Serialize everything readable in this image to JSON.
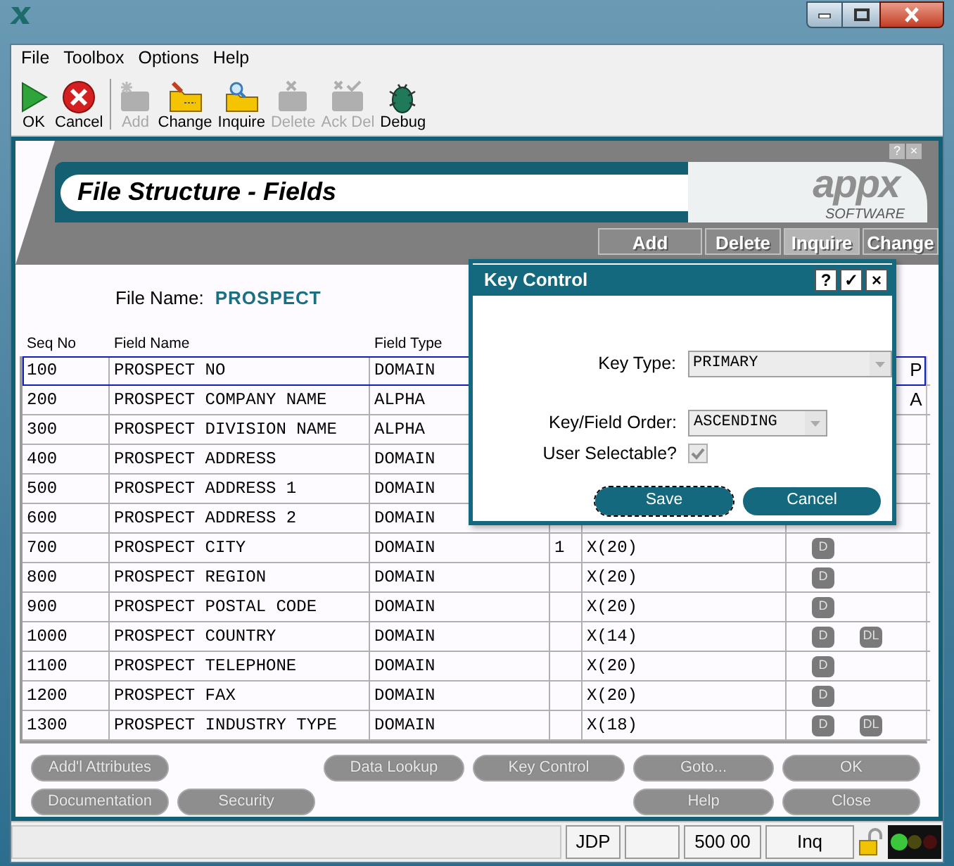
{
  "menu": [
    {
      "label": "File"
    },
    {
      "label": "Toolbox"
    },
    {
      "label": "Options"
    },
    {
      "label": "Help"
    }
  ],
  "toolbar": [
    {
      "kind": "ok",
      "label": "OK",
      "disabled": false
    },
    {
      "kind": "cancel",
      "label": "Cancel",
      "disabled": false
    },
    {
      "kind": "add",
      "label": "Add",
      "disabled": true
    },
    {
      "kind": "change",
      "label": "Change",
      "disabled": false
    },
    {
      "kind": "inquire",
      "label": "Inquire",
      "disabled": false
    },
    {
      "kind": "delete",
      "label": "Delete",
      "disabled": true
    },
    {
      "kind": "ackdel",
      "label": "Ack Del",
      "disabled": true
    },
    {
      "kind": "debug",
      "label": "Debug",
      "disabled": false
    }
  ],
  "screen": {
    "corner_buttons": [
      "?",
      "×"
    ],
    "title": "File Structure - Fields",
    "logo": "appx",
    "logo_sub": "SOFTWARE",
    "modes": [
      {
        "label": "Add",
        "selected": false
      },
      {
        "label": "Delete",
        "selected": false
      },
      {
        "label": "Inquire",
        "selected": true
      },
      {
        "label": "Change",
        "selected": false
      }
    ],
    "file_name_label": "File Name:",
    "file_name": "PROSPECT",
    "columns": [
      "Seq No",
      "Field Name",
      "Field Type"
    ],
    "rows": [
      {
        "seq": "100",
        "name": "PROSPECT NO",
        "type": "DOMAIN",
        "key": "P",
        "selected": true
      },
      {
        "seq": "200",
        "name": "PROSPECT COMPANY NAME",
        "type": "ALPHA",
        "key": "A",
        "selected": false
      },
      {
        "seq": "300",
        "name": "PROSPECT DIVISION NAME",
        "type": "ALPHA",
        "selected": false
      },
      {
        "seq": "400",
        "name": "PROSPECT ADDRESS",
        "type": "DOMAIN",
        "selected": false
      },
      {
        "seq": "500",
        "name": "PROSPECT ADDRESS 1",
        "type": "DOMAIN",
        "selected": false
      },
      {
        "seq": "600",
        "name": "PROSPECT ADDRESS 2",
        "type": "DOMAIN",
        "selected": false
      },
      {
        "seq": "700",
        "name": "PROSPECT CITY",
        "type": "DOMAIN",
        "length": "1",
        "format": "X(20)",
        "badges": [
          "D"
        ],
        "selected": false
      },
      {
        "seq": "800",
        "name": "PROSPECT REGION",
        "type": "DOMAIN",
        "format": "X(20)",
        "badges": [
          "D"
        ],
        "selected": false
      },
      {
        "seq": "900",
        "name": "PROSPECT POSTAL CODE",
        "type": "DOMAIN",
        "format": "X(20)",
        "badges": [
          "D"
        ],
        "selected": false
      },
      {
        "seq": "1000",
        "name": "PROSPECT COUNTRY",
        "type": "DOMAIN",
        "format": "X(14)",
        "badges": [
          "D",
          "DL"
        ],
        "selected": false
      },
      {
        "seq": "1100",
        "name": "PROSPECT TELEPHONE",
        "type": "DOMAIN",
        "format": "X(20)",
        "badges": [
          "D"
        ],
        "selected": false
      },
      {
        "seq": "1200",
        "name": "PROSPECT FAX",
        "type": "DOMAIN",
        "format": "X(20)",
        "badges": [
          "D"
        ],
        "selected": false
      },
      {
        "seq": "1300",
        "name": "PROSPECT INDUSTRY TYPE",
        "type": "DOMAIN",
        "format": "X(18)",
        "badges": [
          "D",
          "DL"
        ],
        "selected": false
      }
    ],
    "buttons": [
      {
        "label": "Add'l Attributes"
      },
      {
        "label": "Data Lookup"
      },
      {
        "label": "Key Control"
      },
      {
        "label": "Goto..."
      },
      {
        "label": "OK"
      },
      {
        "label": "Documentation"
      },
      {
        "label": "Security"
      },
      {
        "label": "Help"
      },
      {
        "label": "Close"
      }
    ]
  },
  "dialog": {
    "title": "Key Control",
    "title_buttons": [
      "?",
      "✓",
      "×"
    ],
    "key_type_label": "Key Type:",
    "key_type": "PRIMARY",
    "order_label": "Key/Field Order:",
    "order": "ASCENDING",
    "selectable_label": "User Selectable?",
    "selectable_checked": true,
    "buttons": [
      {
        "label": "Save"
      },
      {
        "label": "Cancel"
      }
    ]
  },
  "status_bar": {
    "user": "JDP",
    "amount": "500 00",
    "mode": "Inq"
  }
}
